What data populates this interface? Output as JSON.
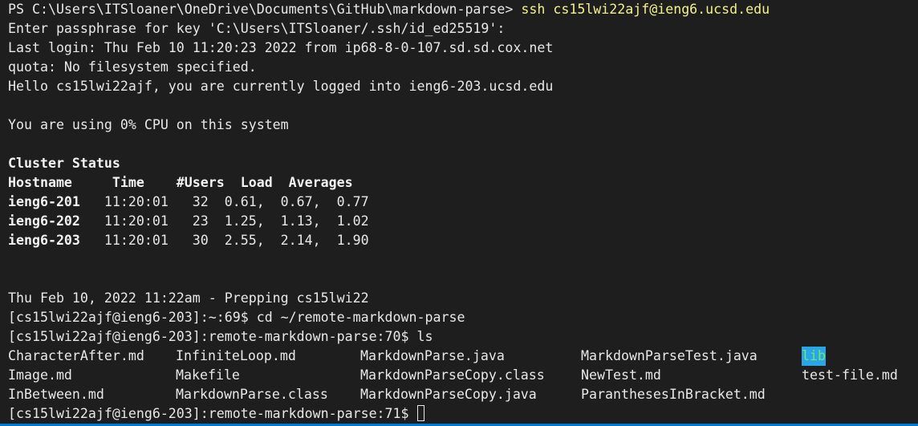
{
  "terminal": {
    "prompt_ps": "PS C:\\Users\\ITSloaner\\OneDrive\\Documents\\GitHub\\markdown-parse> ",
    "ssh_command": "ssh cs15lwi22ajf@ieng6.ucsd.edu",
    "lines": [
      "Enter passphrase for key 'C:\\Users\\ITSloaner/.ssh/id_ed25519':",
      "Last login: Thu Feb 10 11:20:23 2022 from ip68-8-0-107.sd.sd.cox.net",
      "quota: No filesystem specified.",
      "Hello cs15lwi22ajf, you are currently logged into ieng6-203.ucsd.edu",
      "",
      "You are using 0% CPU on this system",
      ""
    ],
    "cluster_title": "Cluster Status",
    "cluster_header": "Hostname     Time    #Users  Load  Averages",
    "cluster_rows": [
      {
        "host": "ieng6-201",
        "rest": "   11:20:01   32  0.61,  0.67,  0.77"
      },
      {
        "host": "ieng6-202",
        "rest": "   11:20:01   23  1.25,  1.13,  1.02"
      },
      {
        "host": "ieng6-203",
        "rest": "   11:20:01   30  2.55,  2.14,  1.90"
      }
    ],
    "prepping_line": "Thu Feb 10, 2022 11:22am - Prepping cs15lwi22",
    "cd_line": "[cs15lwi22ajf@ieng6-203]:~:69$ cd ~/remote-markdown-parse",
    "ls_line": "[cs15lwi22ajf@ieng6-203]:remote-markdown-parse:70$ ls",
    "ls_rows": [
      [
        "CharacterAfter.md",
        "InfiniteLoop.md",
        "MarkdownParse.java",
        "MarkdownParseTest.java",
        "lib"
      ],
      [
        "Image.md",
        "Makefile",
        "MarkdownParseCopy.class",
        "NewTest.md",
        "test-file.md"
      ],
      [
        "InBetween.md",
        "MarkdownParse.class",
        "MarkdownParseCopy.java",
        "ParanthesesInBracket.md",
        ""
      ]
    ],
    "final_prompt": "[cs15lwi22ajf@ieng6-203]:remote-markdown-parse:71$ "
  },
  "colors": {
    "background": "#1e1e1e",
    "text": "#e8e8e8",
    "command_highlight": "#f3f28c",
    "dir_bg": "#2aa6e8",
    "dir_fg": "#6ee86e",
    "status_bar": "#007acc"
  }
}
